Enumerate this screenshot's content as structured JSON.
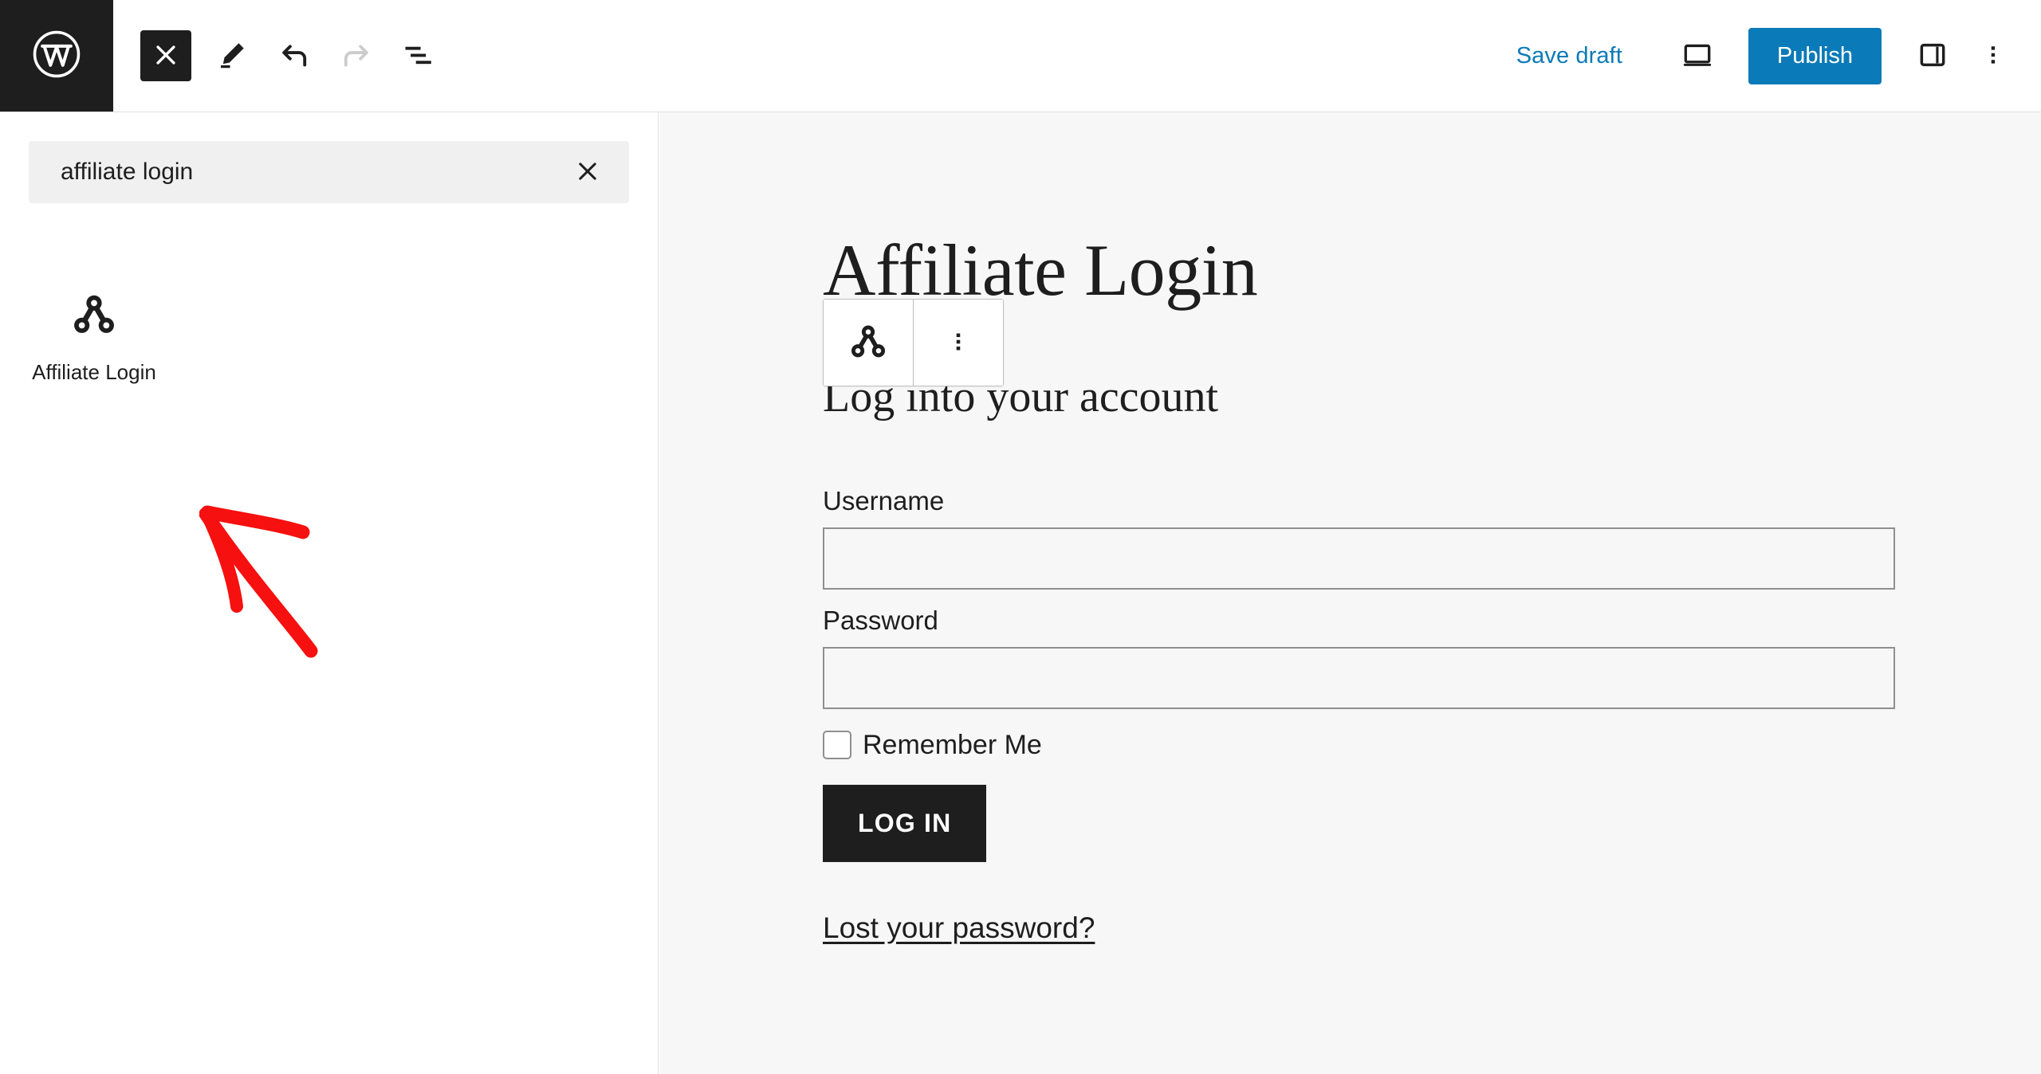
{
  "toolbar": {
    "logo_icon": "wordpress-logo-icon",
    "close_inserter_icon": "close-icon",
    "edit_icon": "pencil-icon",
    "undo_icon": "undo-arrow-icon",
    "redo_icon": "redo-arrow-icon",
    "list_view_icon": "list-view-icon",
    "save_draft_label": "Save draft",
    "preview_icon": "desktop-preview-icon",
    "publish_label": "Publish",
    "settings_panel_icon": "sidebar-panel-icon",
    "options_icon": "vertical-dots-icon",
    "accent_color": "#0b7ab8",
    "dark_color": "#1e1e1e"
  },
  "inserter": {
    "search": {
      "value": "affiliate login",
      "placeholder": "Search",
      "clear_icon": "close-icon"
    },
    "results": [
      {
        "label": "Affiliate Login",
        "icon": "network-nodes-icon"
      }
    ]
  },
  "annotation": {
    "arrow_color": "#f61010",
    "name": "red-arrow-pointing-to-affiliate-login-block"
  },
  "editor": {
    "post_title": "Affiliate Login",
    "block_toolbar": {
      "block_icon": "network-nodes-icon",
      "options_icon": "vertical-dots-icon"
    },
    "sub_heading": "Log into your account",
    "form": {
      "username_label": "Username",
      "username_value": "",
      "password_label": "Password",
      "password_value": "",
      "remember_label": "Remember Me",
      "remember_checked": false,
      "submit_label": "LOG IN",
      "lost_password_label": "Lost your password?"
    }
  }
}
